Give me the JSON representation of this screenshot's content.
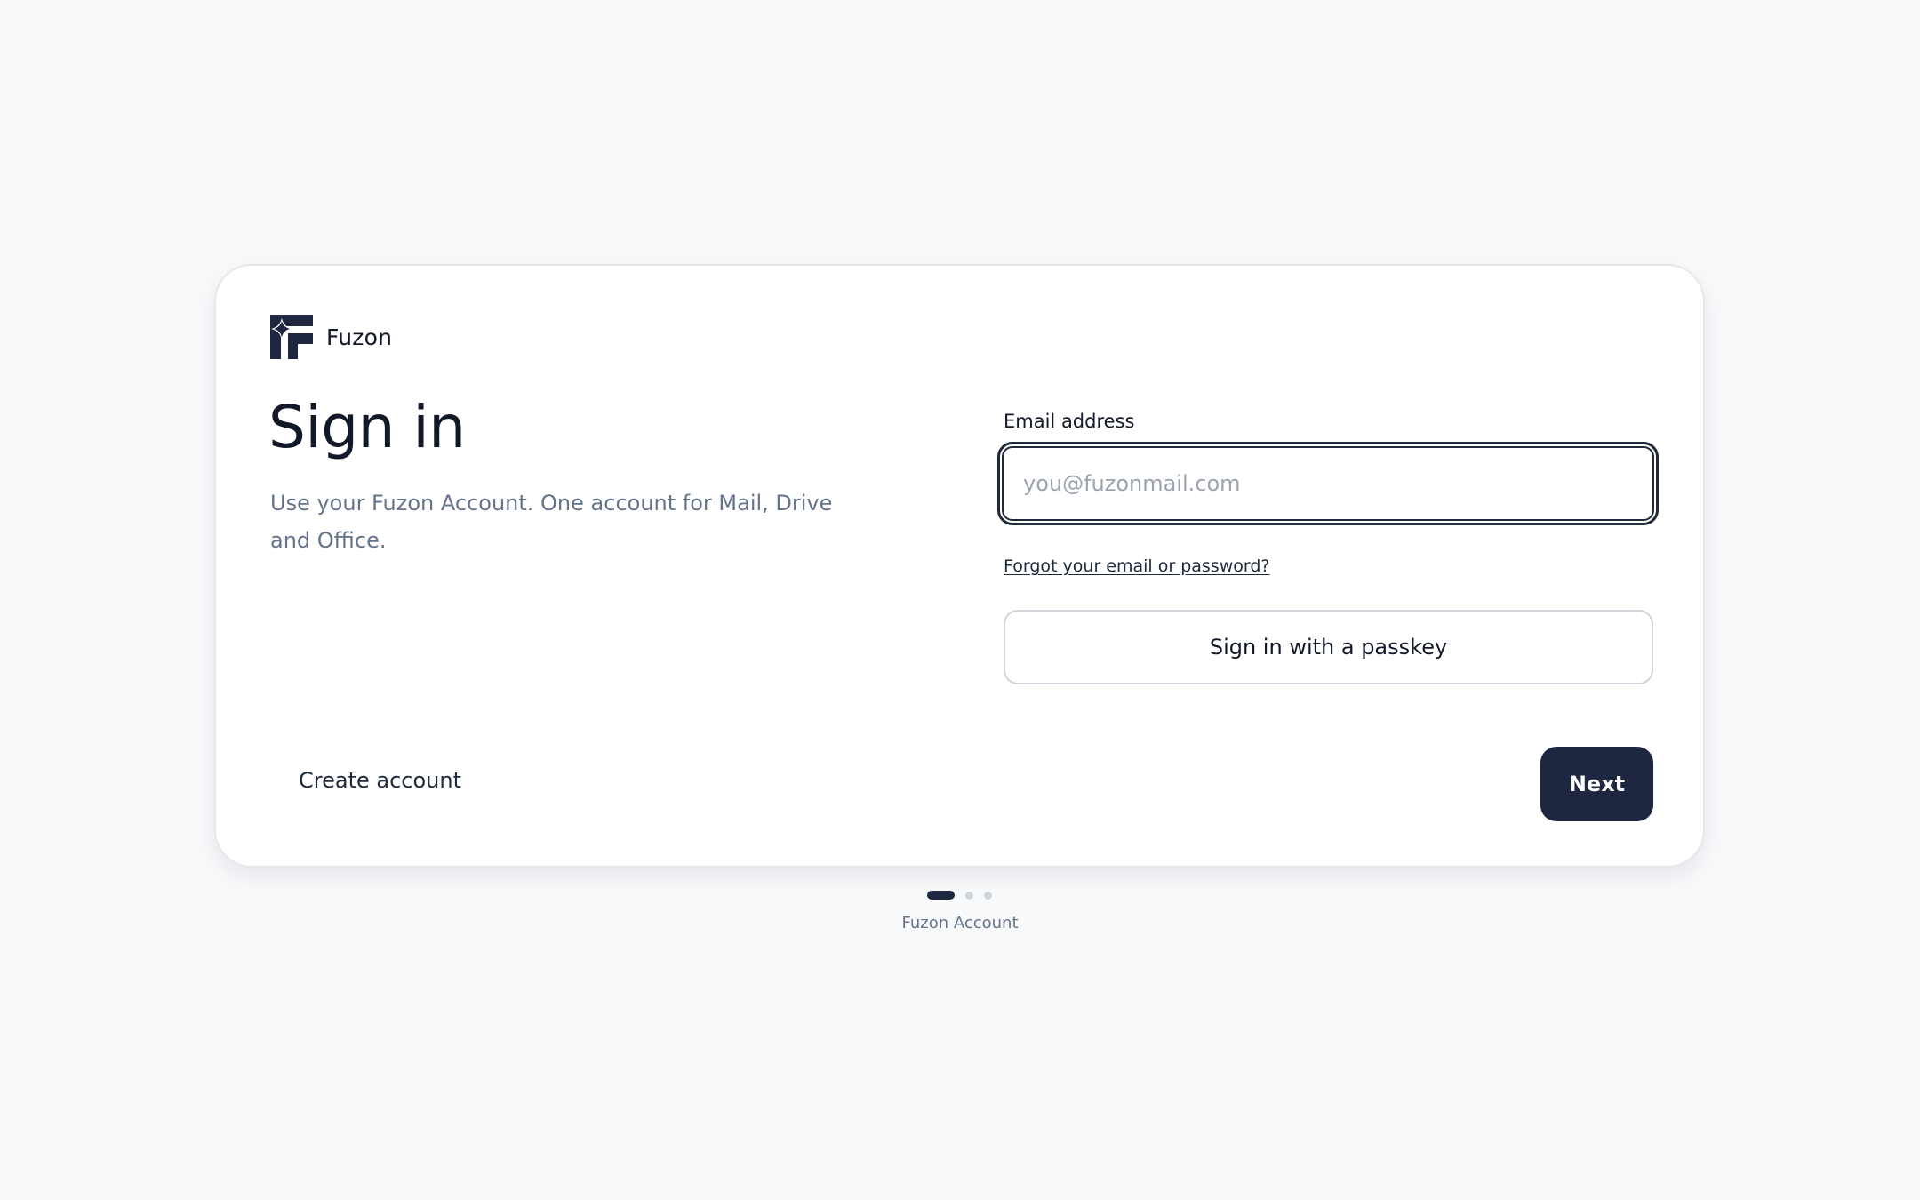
{
  "brand": {
    "name": "Fuzon",
    "logo_icon": "fuzon-logo-icon"
  },
  "signin": {
    "title": "Sign in",
    "subtitle": "Use your Fuzon Account. One account for Mail, Drive and Office."
  },
  "form": {
    "email_label": "Email address",
    "email_placeholder": "you@fuzonmail.com",
    "email_value": "",
    "forgot_link": "Forgot your email or password?",
    "passkey_button": "Sign in with a passkey"
  },
  "actions": {
    "create_account": "Create account",
    "next": "Next"
  },
  "pager": {
    "current_step": 1,
    "total_steps": 3
  },
  "footer": {
    "label": "Fuzon Account"
  },
  "colors": {
    "primary": "#1e2640",
    "background": "#f8f9fb",
    "text_muted": "#64748b"
  }
}
